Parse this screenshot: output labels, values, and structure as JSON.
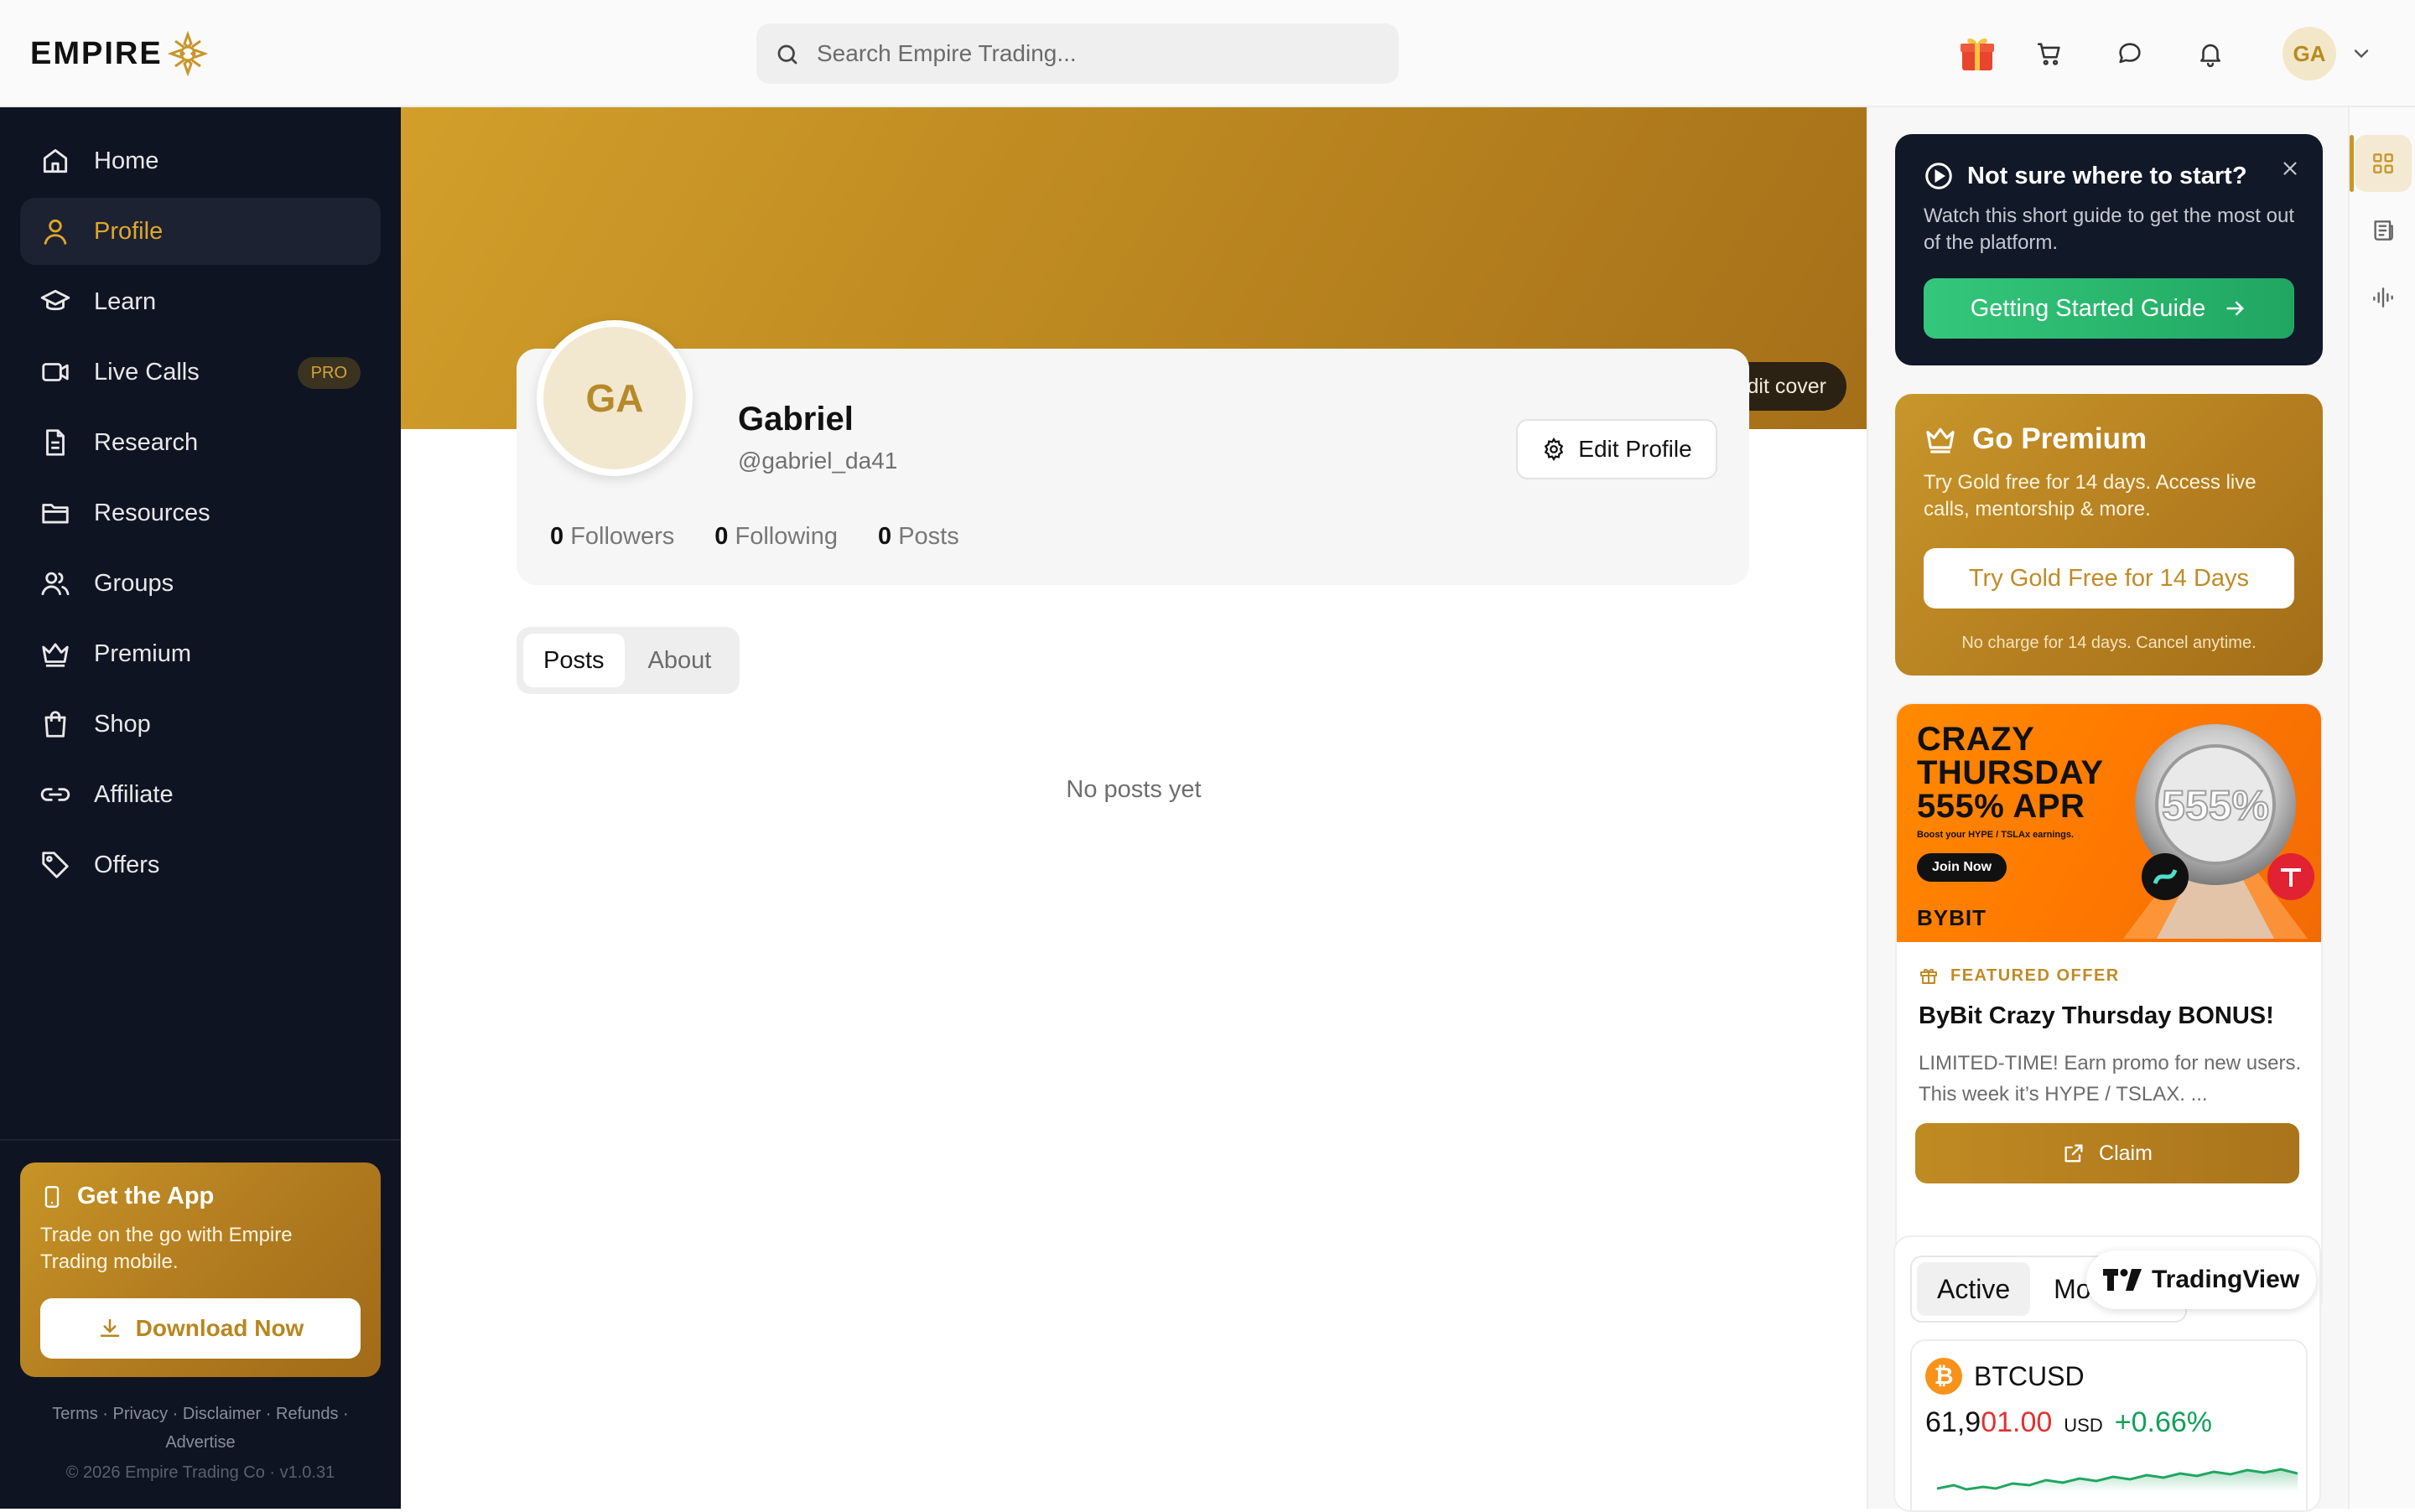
{
  "brand": {
    "name": "EMPIRE"
  },
  "search": {
    "placeholder": "Search Empire Trading..."
  },
  "header": {
    "icons": [
      "gift-icon",
      "cart-icon",
      "chat-icon",
      "bell-icon"
    ],
    "avatar_initials": "GA"
  },
  "colors": {
    "gold": "#c8962b",
    "sidebar_bg": "#0f1422",
    "green": "#20a661",
    "offer_orange": "#ff7a00"
  },
  "sidebar": {
    "items": [
      {
        "label": "Home",
        "icon": "home-icon"
      },
      {
        "label": "Profile",
        "icon": "user-icon",
        "active": true
      },
      {
        "label": "Learn",
        "icon": "graduation-cap-icon"
      },
      {
        "label": "Live Calls",
        "icon": "video-icon",
        "badge": "PRO"
      },
      {
        "label": "Research",
        "icon": "document-icon"
      },
      {
        "label": "Resources",
        "icon": "folder-icon"
      },
      {
        "label": "Groups",
        "icon": "users-icon"
      },
      {
        "label": "Premium",
        "icon": "crown-icon"
      },
      {
        "label": "Shop",
        "icon": "shopping-bag-icon"
      },
      {
        "label": "Affiliate",
        "icon": "link-icon"
      },
      {
        "label": "Offers",
        "icon": "tag-icon"
      }
    ],
    "app_card": {
      "title": "Get the App",
      "text": "Trade on the go with Empire Trading mobile.",
      "button": "Download Now"
    },
    "footer_links": [
      "Terms",
      "Privacy",
      "Disclaimer",
      "Refunds",
      "Advertise"
    ],
    "copyright": "© 2026 Empire Trading Co",
    "version": "v1.0.31"
  },
  "profile": {
    "edit_cover": "Edit cover",
    "initials": "GA",
    "name": "Gabriel",
    "handle": "@gabriel_da41",
    "edit_button": "Edit Profile",
    "stats": [
      {
        "value": "0",
        "label": "Followers"
      },
      {
        "value": "0",
        "label": "Following"
      },
      {
        "value": "0",
        "label": "Posts"
      }
    ],
    "tabs": [
      {
        "label": "Posts",
        "active": true
      },
      {
        "label": "About"
      }
    ],
    "empty_text": "No posts yet"
  },
  "guide": {
    "title": "Not sure where to start?",
    "text": "Watch this short guide to get the most out of the platform.",
    "button": "Getting Started Guide"
  },
  "premium": {
    "title": "Go Premium",
    "text": "Try Gold free for 14 days. Access live calls, mentorship & more.",
    "button": "Try Gold Free for 14 Days",
    "note": "No charge for 14 days. Cancel anytime."
  },
  "offer": {
    "banner_line1": "CRAZY",
    "banner_line2": "THURSDAY",
    "banner_line3": "555% APR",
    "banner_sub": "Boost your HYPE / TSLAx earnings.",
    "banner_join": "Join Now",
    "banner_logo": "BYBIT",
    "banner_badge": "555%",
    "tag": "FEATURED OFFER",
    "title": "ByBit Crazy Thursday BONUS!",
    "desc": "LIMITED-TIME! Earn promo for new users. This week it’s HYPE / TSLAX. ...",
    "button": "Claim"
  },
  "tradingview": {
    "tabs": [
      "Active",
      "Movers"
    ],
    "brand": "TradingView",
    "symbol": "BTCUSD",
    "price_prefix": "61,9",
    "price_suffix": "01.00",
    "unit": "USD",
    "change": "+0.66%"
  },
  "rail": {
    "icons": [
      "grid-icon",
      "newspaper-icon",
      "waveform-icon"
    ]
  }
}
